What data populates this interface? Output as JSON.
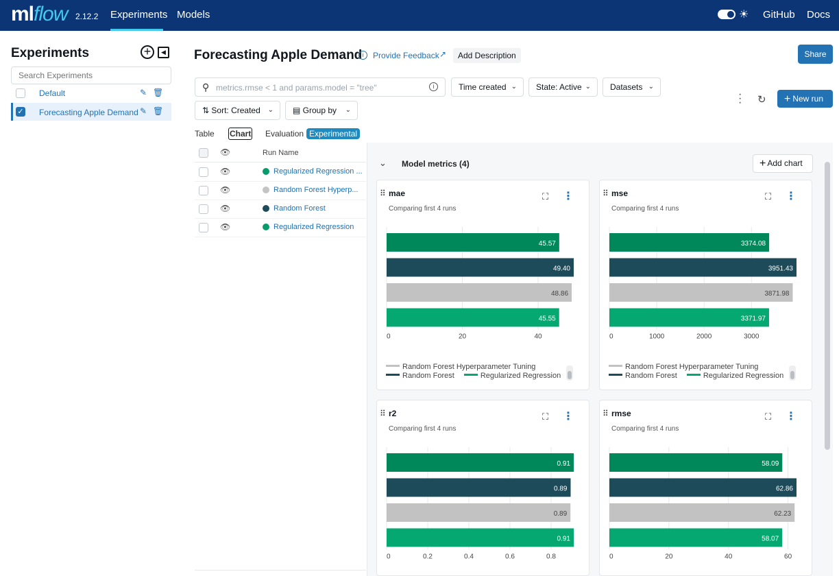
{
  "topnav": {
    "logo_ml": "ml",
    "logo_flow": "flow",
    "version": "2.12.2",
    "tabs": [
      {
        "label": "Experiments",
        "active": true
      },
      {
        "label": "Models",
        "active": false
      }
    ],
    "github": "GitHub",
    "docs": "Docs"
  },
  "sidebar": {
    "title": "Experiments",
    "search_placeholder": "Search Experiments",
    "items": [
      {
        "label": "Default",
        "checked": false
      },
      {
        "label": "Forecasting Apple Demand",
        "checked": true
      }
    ]
  },
  "header": {
    "title": "Forecasting Apple Demand",
    "feedback": "Provide Feedback",
    "add_description": "Add Description",
    "share": "Share"
  },
  "filters": {
    "search_placeholder": "metrics.rmse < 1 and params.model = \"tree\"",
    "time_created": "Time created",
    "state": "State: Active",
    "datasets": "Datasets",
    "sort": "Sort: Created",
    "group_by": "Group by",
    "new_run": "New run"
  },
  "view_tabs": {
    "table": "Table",
    "chart": "Chart",
    "evaluation": "Evaluation",
    "experimental": "Experimental"
  },
  "runs": {
    "header": "Run Name",
    "rows": [
      {
        "name": "Regularized Regression ...",
        "color": "#0a9b6c"
      },
      {
        "name": "Random Forest Hyperp...",
        "color": "#c4c4c4"
      },
      {
        "name": "Random Forest",
        "color": "#1d4b5a"
      },
      {
        "name": "Regularized Regression",
        "color": "#0a9b6c"
      }
    ]
  },
  "section": {
    "title": "Model metrics (4)",
    "add_chart": "Add chart"
  },
  "legend": {
    "hyper": "Random Forest Hyperparameter Tuning",
    "rf": "Random Forest",
    "reg": "Regularized Regression"
  },
  "colors": {
    "reg1": "#00875a",
    "rf": "#1d4b5a",
    "hyper": "#c2c2c2",
    "reg2": "#06a872",
    "accent": "#2272b4",
    "nav": "#0b3574"
  },
  "chart_data": [
    {
      "type": "bar",
      "title": "mae",
      "subtitle": "Comparing first 4 runs",
      "xlim": [
        0,
        49.4
      ],
      "ticks": [
        0,
        20,
        40
      ],
      "series": [
        {
          "name": "Regularized Regression",
          "value": 45.57,
          "label": "45.57",
          "color": "#00875a"
        },
        {
          "name": "Random Forest",
          "value": 49.4,
          "label": "49.40",
          "color": "#1d4b5a"
        },
        {
          "name": "Random Forest Hyperparameter Tuning",
          "value": 48.86,
          "label": "48.86",
          "color": "#c2c2c2"
        },
        {
          "name": "Regularized Regression",
          "value": 45.55,
          "label": "45.55",
          "color": "#06a872"
        }
      ]
    },
    {
      "type": "bar",
      "title": "mse",
      "subtitle": "Comparing first 4 runs",
      "xlim": [
        0,
        3951.43
      ],
      "ticks": [
        0,
        1000,
        2000,
        3000
      ],
      "series": [
        {
          "name": "Regularized Regression",
          "value": 3374.08,
          "label": "3374.08",
          "color": "#00875a"
        },
        {
          "name": "Random Forest",
          "value": 3951.43,
          "label": "3951.43",
          "color": "#1d4b5a"
        },
        {
          "name": "Random Forest Hyperparameter Tuning",
          "value": 3871.98,
          "label": "3871.98",
          "color": "#c2c2c2"
        },
        {
          "name": "Regularized Regression",
          "value": 3371.97,
          "label": "3371.97",
          "color": "#06a872"
        }
      ]
    },
    {
      "type": "bar",
      "title": "r2",
      "subtitle": "Comparing first 4 runs",
      "xlim": [
        0,
        0.91
      ],
      "ticks": [
        0,
        0.2,
        0.4,
        0.6,
        0.8
      ],
      "series": [
        {
          "name": "Regularized Regression",
          "value": 0.91,
          "label": "0.91",
          "color": "#00875a"
        },
        {
          "name": "Random Forest",
          "value": 0.895,
          "label": "0.89",
          "color": "#1d4b5a"
        },
        {
          "name": "Random Forest Hyperparameter Tuning",
          "value": 0.894,
          "label": "0.89",
          "color": "#c2c2c2"
        },
        {
          "name": "Regularized Regression",
          "value": 0.91,
          "label": "0.91",
          "color": "#06a872"
        }
      ]
    },
    {
      "type": "bar",
      "title": "rmse",
      "subtitle": "Comparing first 4 runs",
      "xlim": [
        0,
        62.86
      ],
      "ticks": [
        0,
        20,
        40,
        60
      ],
      "series": [
        {
          "name": "Regularized Regression",
          "value": 58.09,
          "label": "58.09",
          "color": "#00875a"
        },
        {
          "name": "Random Forest",
          "value": 62.86,
          "label": "62.86",
          "color": "#1d4b5a"
        },
        {
          "name": "Random Forest Hyperparameter Tuning",
          "value": 62.23,
          "label": "62.23",
          "color": "#c2c2c2"
        },
        {
          "name": "Regularized Regression",
          "value": 58.07,
          "label": "58.07",
          "color": "#06a872"
        }
      ]
    }
  ]
}
